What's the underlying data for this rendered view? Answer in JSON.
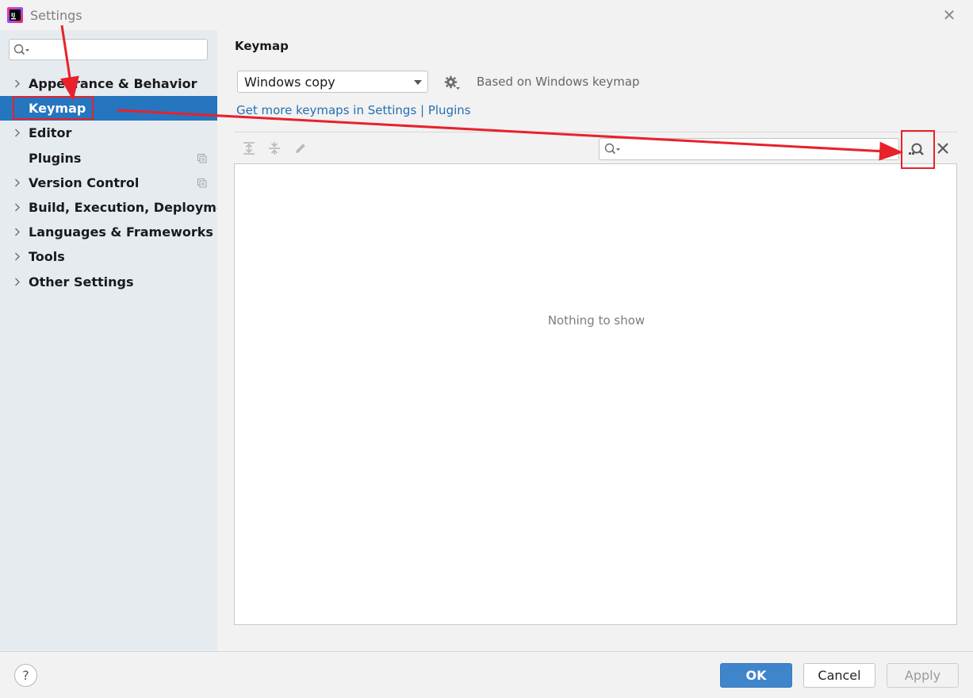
{
  "window": {
    "title": "Settings",
    "close_icon": "close-icon"
  },
  "sidebar": {
    "search_placeholder": "",
    "items": [
      {
        "label": "Appearance & Behavior",
        "expandable": true
      },
      {
        "label": "Keymap",
        "expandable": false,
        "selected": true
      },
      {
        "label": "Editor",
        "expandable": true
      },
      {
        "label": "Plugins",
        "expandable": false,
        "project_icon": true
      },
      {
        "label": "Version Control",
        "expandable": true,
        "project_icon": true
      },
      {
        "label": "Build, Execution, Deployment",
        "expandable": true
      },
      {
        "label": "Languages & Frameworks",
        "expandable": true
      },
      {
        "label": "Tools",
        "expandable": true
      },
      {
        "label": "Other Settings",
        "expandable": true
      }
    ]
  },
  "main": {
    "title": "Keymap",
    "keymap_select": "Windows copy",
    "based_on": "Based on Windows keymap",
    "get_more_link": "Get more keymaps in Settings | Plugins",
    "filter_placeholder": "",
    "empty_text": "Nothing to show"
  },
  "footer": {
    "help": "?",
    "ok": "OK",
    "cancel": "Cancel",
    "apply": "Apply"
  },
  "colors": {
    "selection": "#2675bf",
    "link": "#2470b3",
    "ok_button": "#3f85cc",
    "annotation": "#e8212b"
  }
}
